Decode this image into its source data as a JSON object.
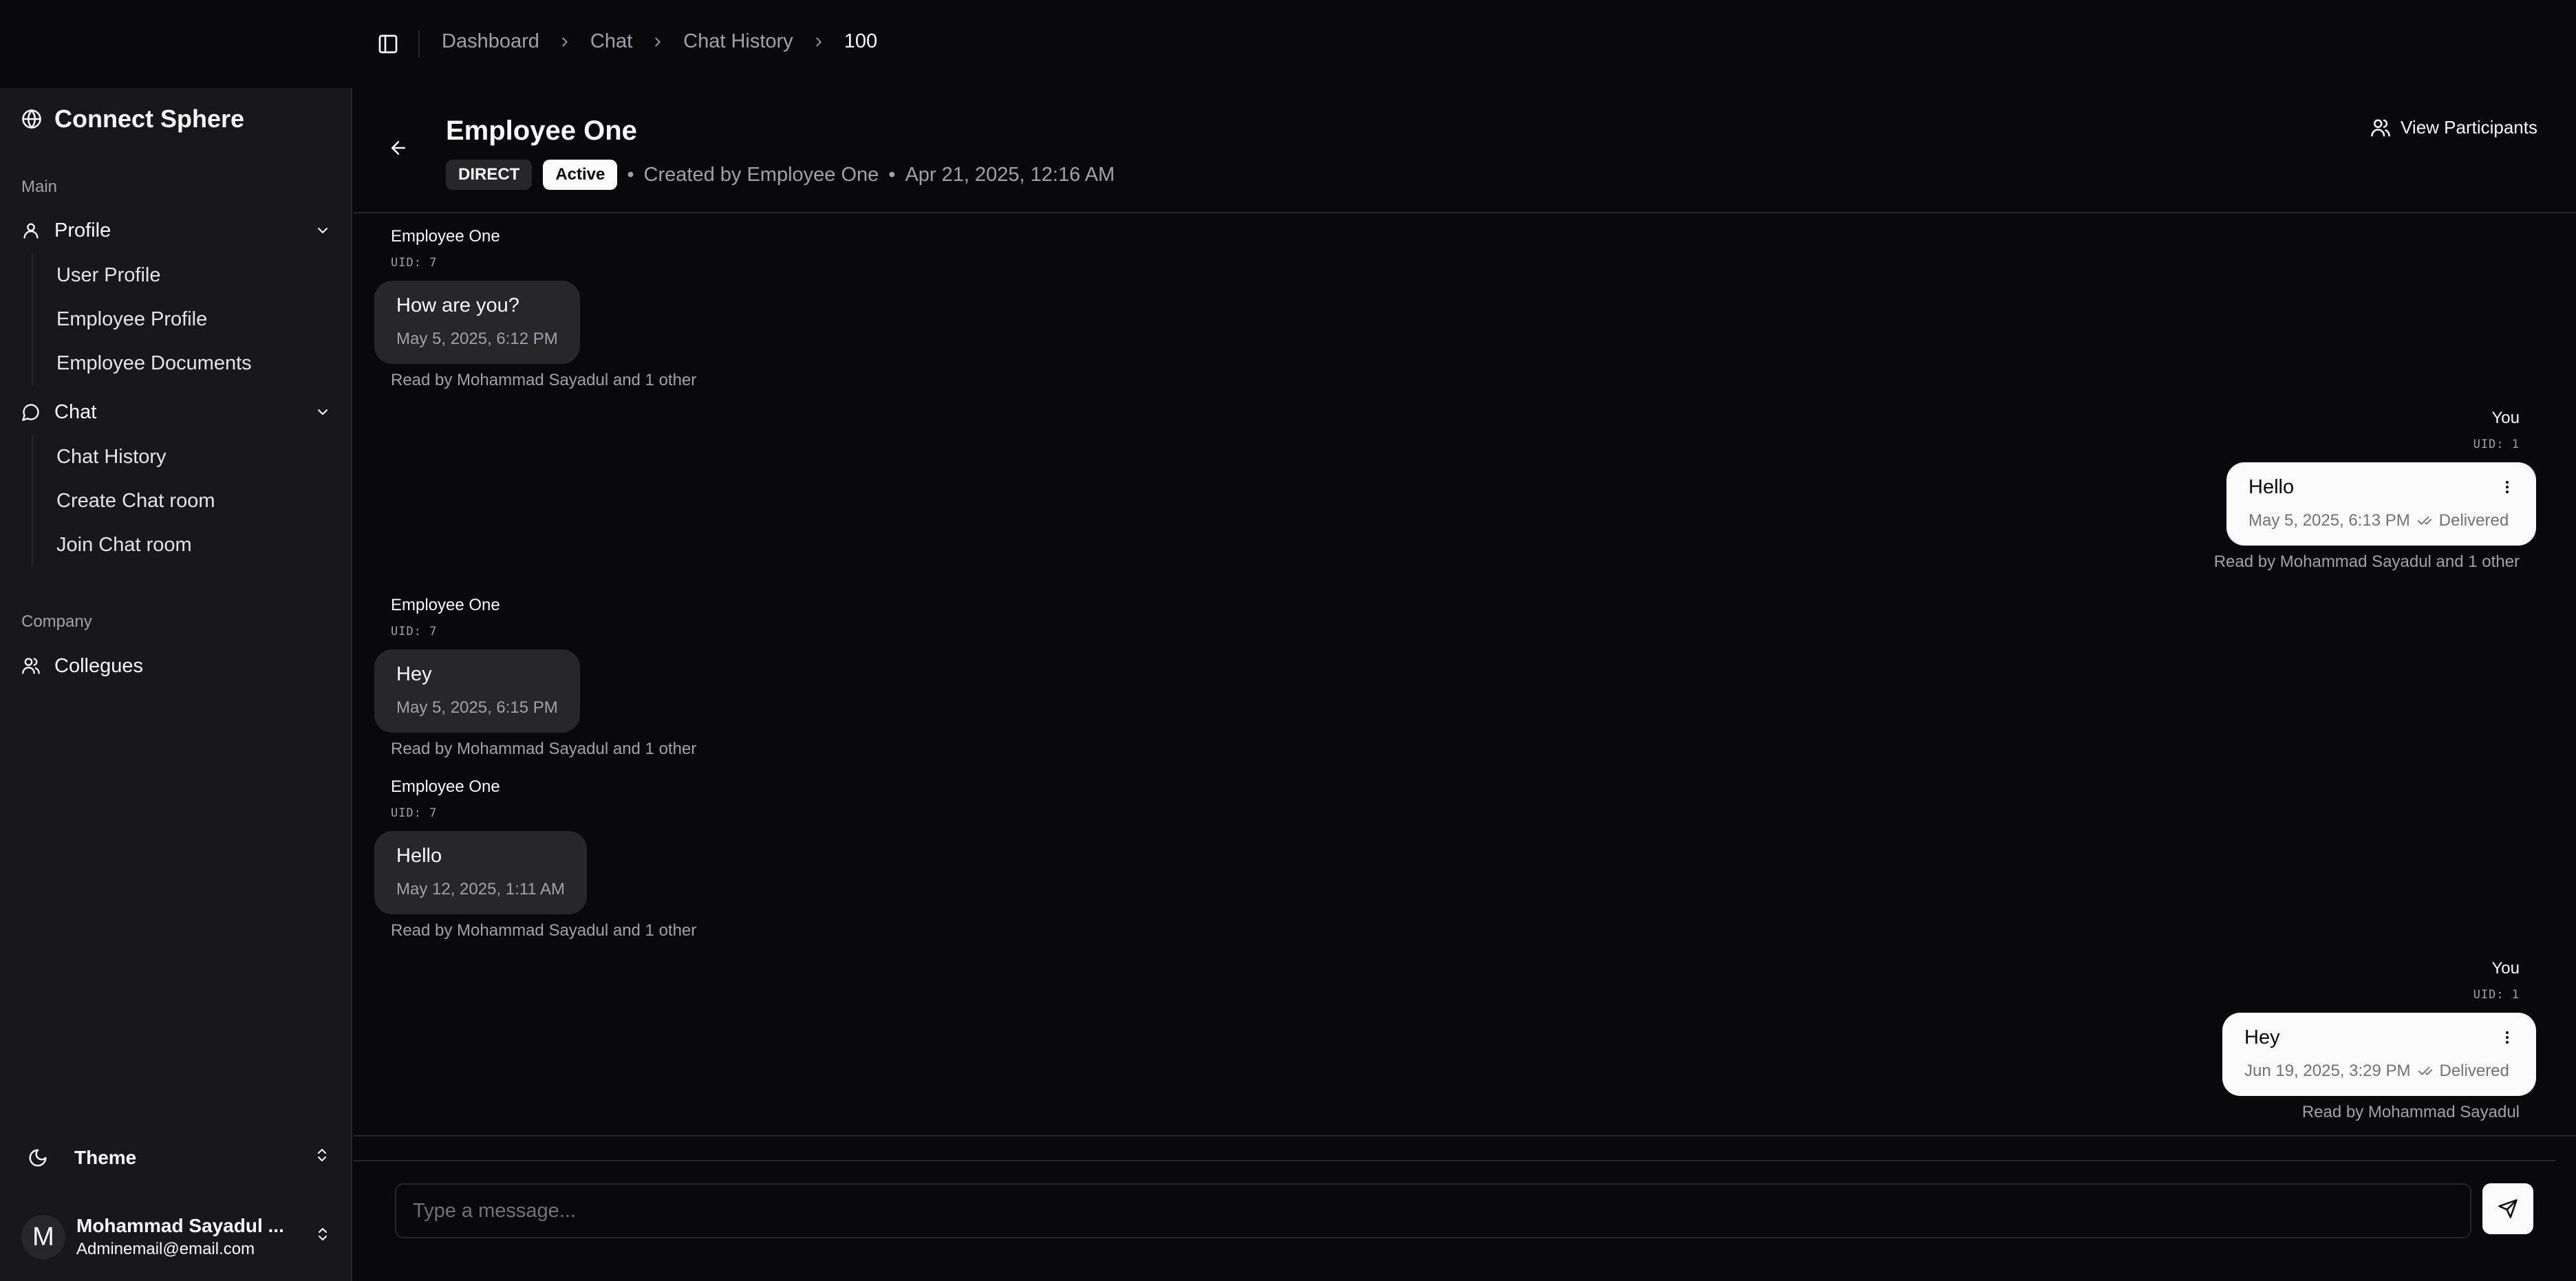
{
  "app": {
    "name": "Connect Sphere"
  },
  "sidebar": {
    "main_label": "Main",
    "profile": {
      "label": "Profile",
      "items": [
        "User Profile",
        "Employee Profile",
        "Employee Documents"
      ]
    },
    "chat": {
      "label": "Chat",
      "items": [
        "Chat History",
        "Create Chat room",
        "Join Chat room"
      ]
    },
    "company_label": "Company",
    "collegues_label": "Collegues",
    "theme_label": "Theme",
    "user": {
      "initial": "M",
      "name": "Mohammad Sayadul ...",
      "email": "Adminemail@email.com"
    }
  },
  "breadcrumb": [
    "Dashboard",
    "Chat",
    "Chat History",
    "100"
  ],
  "chat": {
    "title": "Employee One",
    "type_badge": "DIRECT",
    "status_badge": "Active",
    "created_by": "Created by Employee One",
    "created_at": "Apr 21, 2025, 12:16 AM",
    "view_participants": "View Participants"
  },
  "messages": [
    {
      "sender": "Employee One",
      "uid": "UID: 7",
      "text": "How are you?",
      "time": "May 5, 2025, 6:12 PM",
      "status": "",
      "read": "Read by Mohammad Sayadul and 1 other"
    },
    {
      "sender": "You",
      "uid": "UID: 1",
      "text": "Hello",
      "time": "May 5, 2025, 6:13 PM",
      "status": "Delivered",
      "read": "Read by Mohammad Sayadul and 1 other"
    },
    {
      "sender": "Employee One",
      "uid": "UID: 7",
      "text": "Hey",
      "time": "May 5, 2025, 6:15 PM",
      "status": "",
      "read": "Read by Mohammad Sayadul and 1 other"
    },
    {
      "sender": "Employee One",
      "uid": "UID: 7",
      "text": "Hello",
      "time": "May 12, 2025, 1:11 AM",
      "status": "",
      "read": "Read by Mohammad Sayadul and 1 other"
    },
    {
      "sender": "You",
      "uid": "UID: 1",
      "text": "Hey",
      "time": "Jun 19, 2025, 3:29 PM",
      "status": "Delivered",
      "read": "Read by Mohammad Sayadul"
    }
  ],
  "composer": {
    "placeholder": "Type a message..."
  },
  "icons": {
    "brand": "globe-icon",
    "profile": "user-icon",
    "chat": "message-circle-icon",
    "collegues": "users-icon",
    "theme": "moon-icon",
    "toggle": "panel-left-icon",
    "back": "arrow-left-icon",
    "participants": "users-icon",
    "send": "send-icon",
    "kebab": "more-vertical-icon",
    "delivered": "check-check-icon"
  }
}
